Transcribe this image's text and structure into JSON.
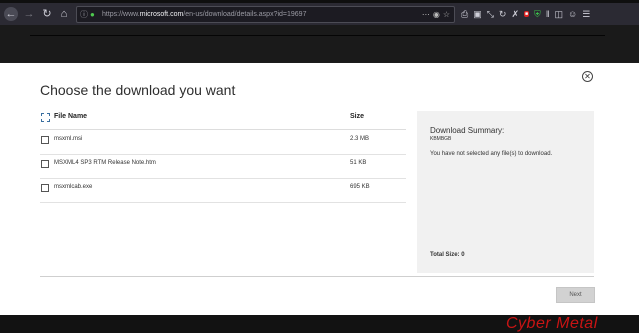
{
  "browser": {
    "url_prefix": "https://www.",
    "url_domain": "microsoft.com",
    "url_path": "/en-us/download/details.aspx?id=19697"
  },
  "dialog": {
    "title": "Choose the download you want",
    "columns": {
      "name": "File Name",
      "size": "Size"
    },
    "files": [
      {
        "name": "msxml.msi",
        "size": "2.3 MB"
      },
      {
        "name": "MSXML4 SP3 RTM Release Note.htm",
        "size": "51 KB"
      },
      {
        "name": "msxmlcab.exe",
        "size": "695 KB"
      }
    ],
    "summary": {
      "title": "Download Summary:",
      "kb": "KBMBGB",
      "message": "You have not selected any file(s) to download.",
      "total": "Total Size: 0"
    },
    "next_label": "Next"
  },
  "watermark": "Cyber Metal"
}
